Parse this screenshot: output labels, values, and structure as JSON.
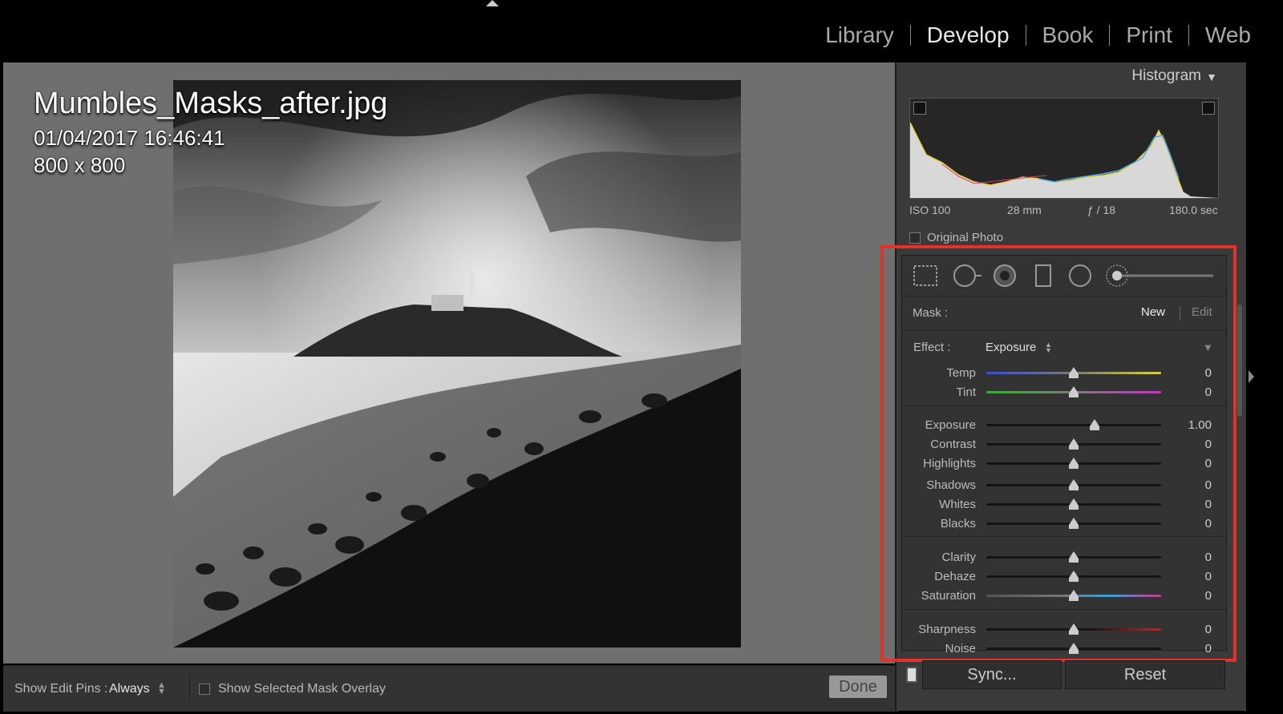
{
  "modules": [
    "Library",
    "Develop",
    "Book",
    "Print",
    "Web"
  ],
  "active_module": "Develop",
  "photo": {
    "filename": "Mumbles_Masks_after.jpg",
    "datetime": "01/04/2017 16:46:41",
    "dimensions": "800 x 800"
  },
  "toolbar": {
    "show_edit_pins_label": "Show Edit Pins :",
    "show_edit_pins_value": "Always",
    "overlay_label": "Show Selected Mask Overlay",
    "done_label": "Done"
  },
  "histogram": {
    "title": "Histogram",
    "iso": "ISO 100",
    "focal": "28 mm",
    "aperture": "ƒ / 18",
    "shutter": "180.0 sec",
    "original_photo_label": "Original Photo"
  },
  "mask": {
    "label": "Mask :",
    "new_label": "New",
    "edit_label": "Edit",
    "effect_label": "Effect :",
    "effect_value": "Exposure"
  },
  "sliders": [
    {
      "label": "Temp",
      "value": "0",
      "pos": 0.5
    },
    {
      "label": "Tint",
      "value": "0",
      "pos": 0.5
    },
    {
      "label": "Exposure",
      "value": "1.00",
      "pos": 0.62
    },
    {
      "label": "Contrast",
      "value": "0",
      "pos": 0.5
    },
    {
      "label": "Highlights",
      "value": "0",
      "pos": 0.5
    },
    {
      "label": "Shadows",
      "value": "0",
      "pos": 0.5
    },
    {
      "label": "Whites",
      "value": "0",
      "pos": 0.5
    },
    {
      "label": "Blacks",
      "value": "0",
      "pos": 0.5
    },
    {
      "label": "Clarity",
      "value": "0",
      "pos": 0.5
    },
    {
      "label": "Dehaze",
      "value": "0",
      "pos": 0.5
    },
    {
      "label": "Saturation",
      "value": "0",
      "pos": 0.5
    },
    {
      "label": "Sharpness",
      "value": "0",
      "pos": 0.5
    },
    {
      "label": "Noise",
      "value": "0",
      "pos": 0.5
    }
  ],
  "buttons": {
    "sync": "Sync...",
    "reset": "Reset"
  },
  "colors": {
    "highlight_border": "#e8302a",
    "panel_bg": "#3a3a3a",
    "workspace_bg": "#6f6f6f"
  }
}
